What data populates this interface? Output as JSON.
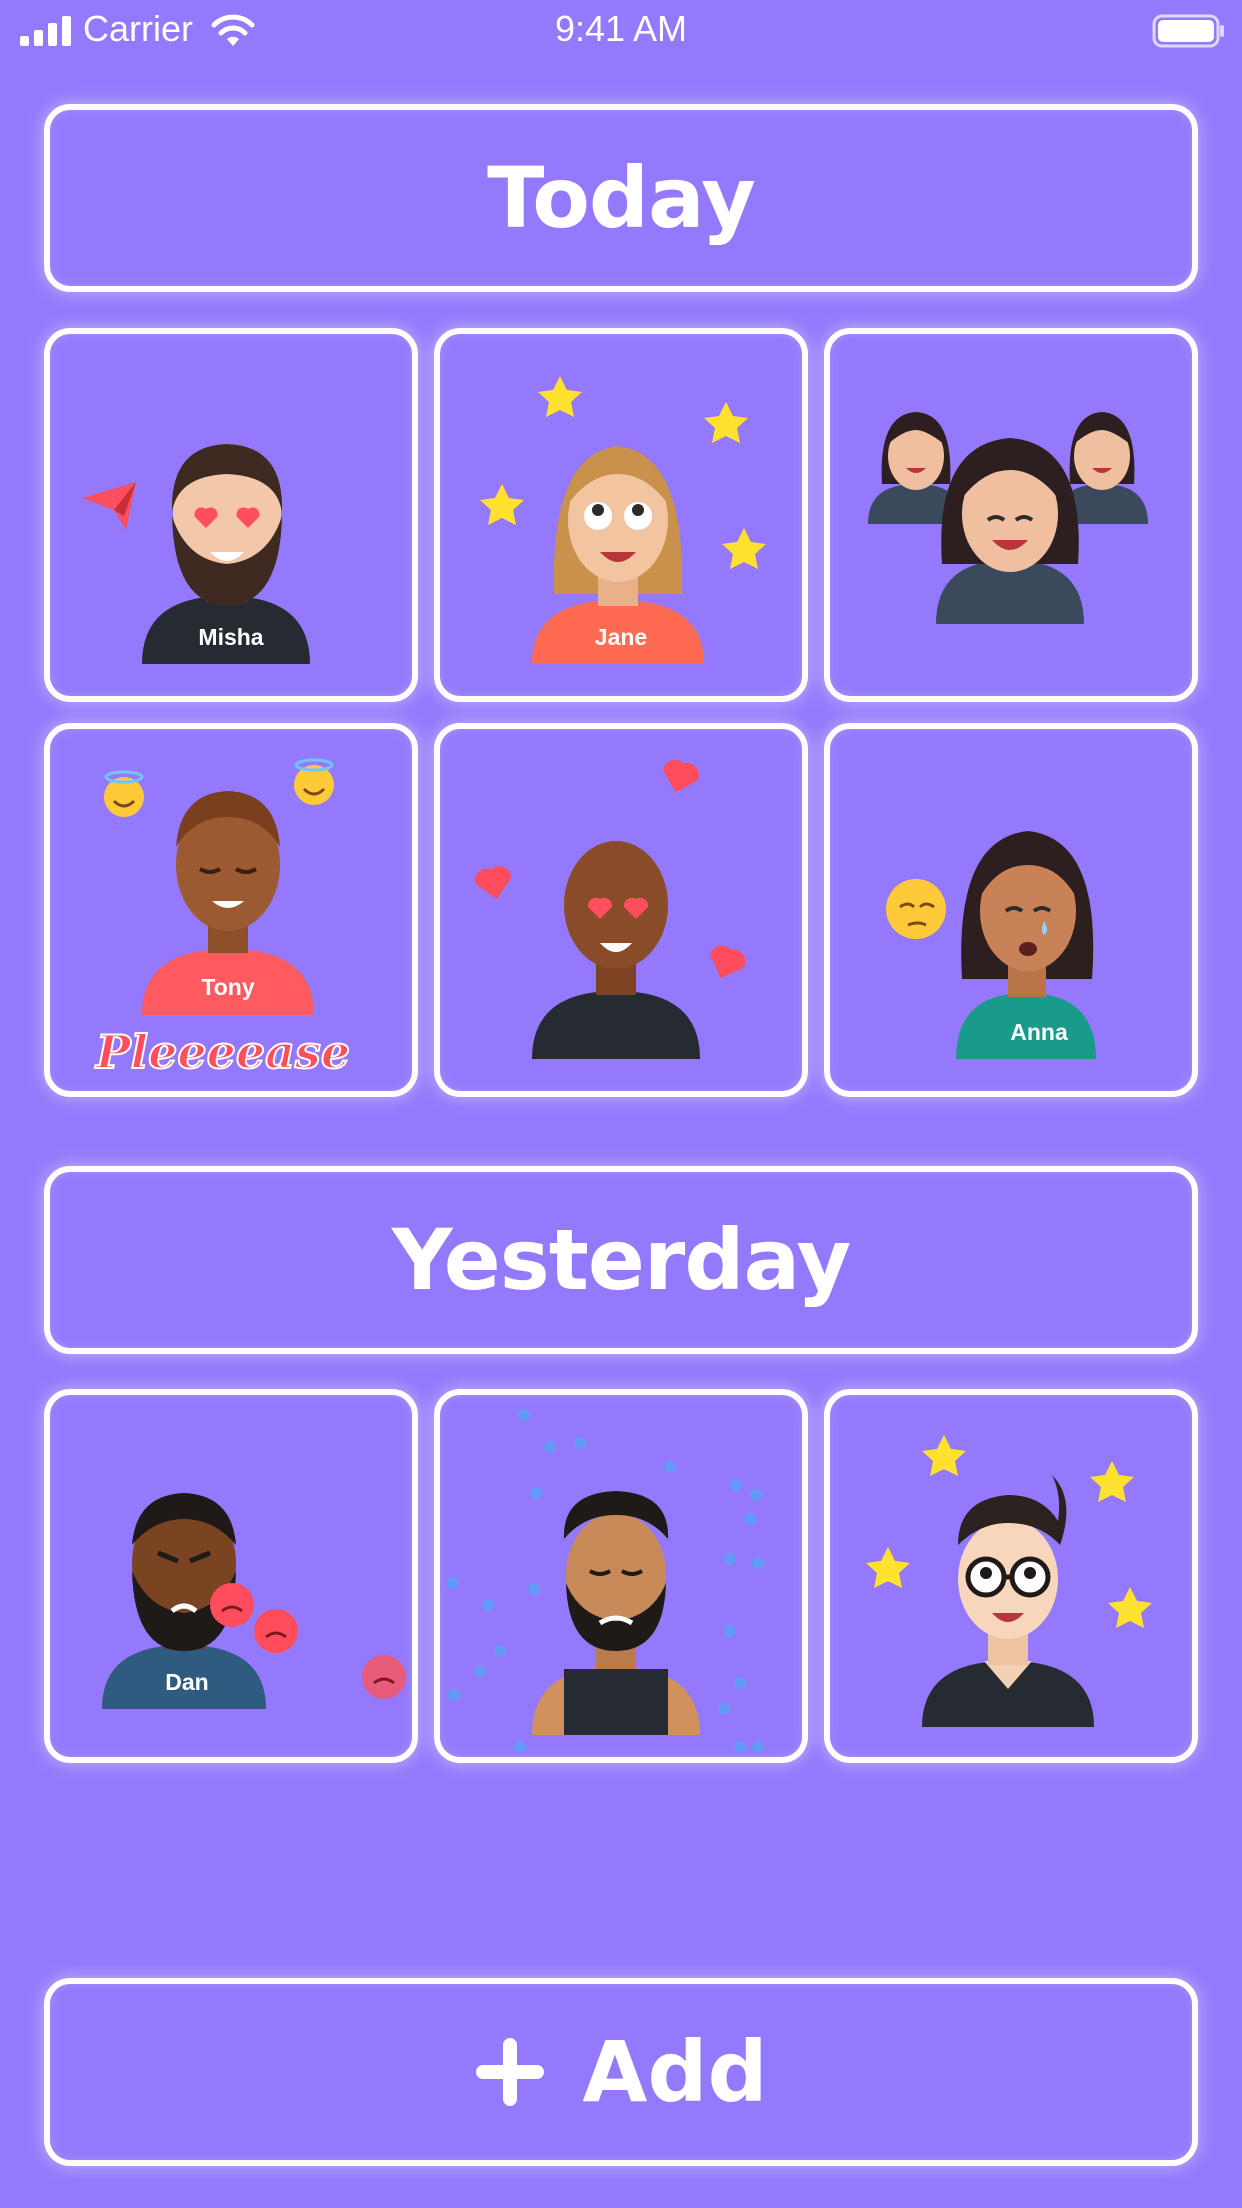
{
  "status_bar": {
    "carrier": "Carrier",
    "time": "9:41 AM",
    "icons": [
      "signal-icon",
      "wifi-icon",
      "battery-icon"
    ]
  },
  "sections": [
    {
      "title": "Today",
      "tiles": [
        {
          "name": "Misha",
          "effect": "paper-plane"
        },
        {
          "name": "Jane",
          "effect": "stars"
        },
        {
          "name": "",
          "effect": "group"
        },
        {
          "name": "Tony",
          "effect": "halo-emoji",
          "caption": "Pleeeease"
        },
        {
          "name": "",
          "effect": "hearts"
        },
        {
          "name": "Anna",
          "effect": "pensive-emoji"
        }
      ]
    },
    {
      "title": "Yesterday",
      "tiles": [
        {
          "name": "Dan",
          "effect": "angry-emoji"
        },
        {
          "name": "",
          "effect": "tears-dots"
        },
        {
          "name": "",
          "effect": "stars"
        }
      ]
    }
  ],
  "add_button": {
    "label": "Add",
    "icon": "plus-icon"
  },
  "colors": {
    "background": "#9479fc",
    "border": "#ffffff",
    "star": "#ffe12e",
    "heart": "#ff4d5e"
  }
}
